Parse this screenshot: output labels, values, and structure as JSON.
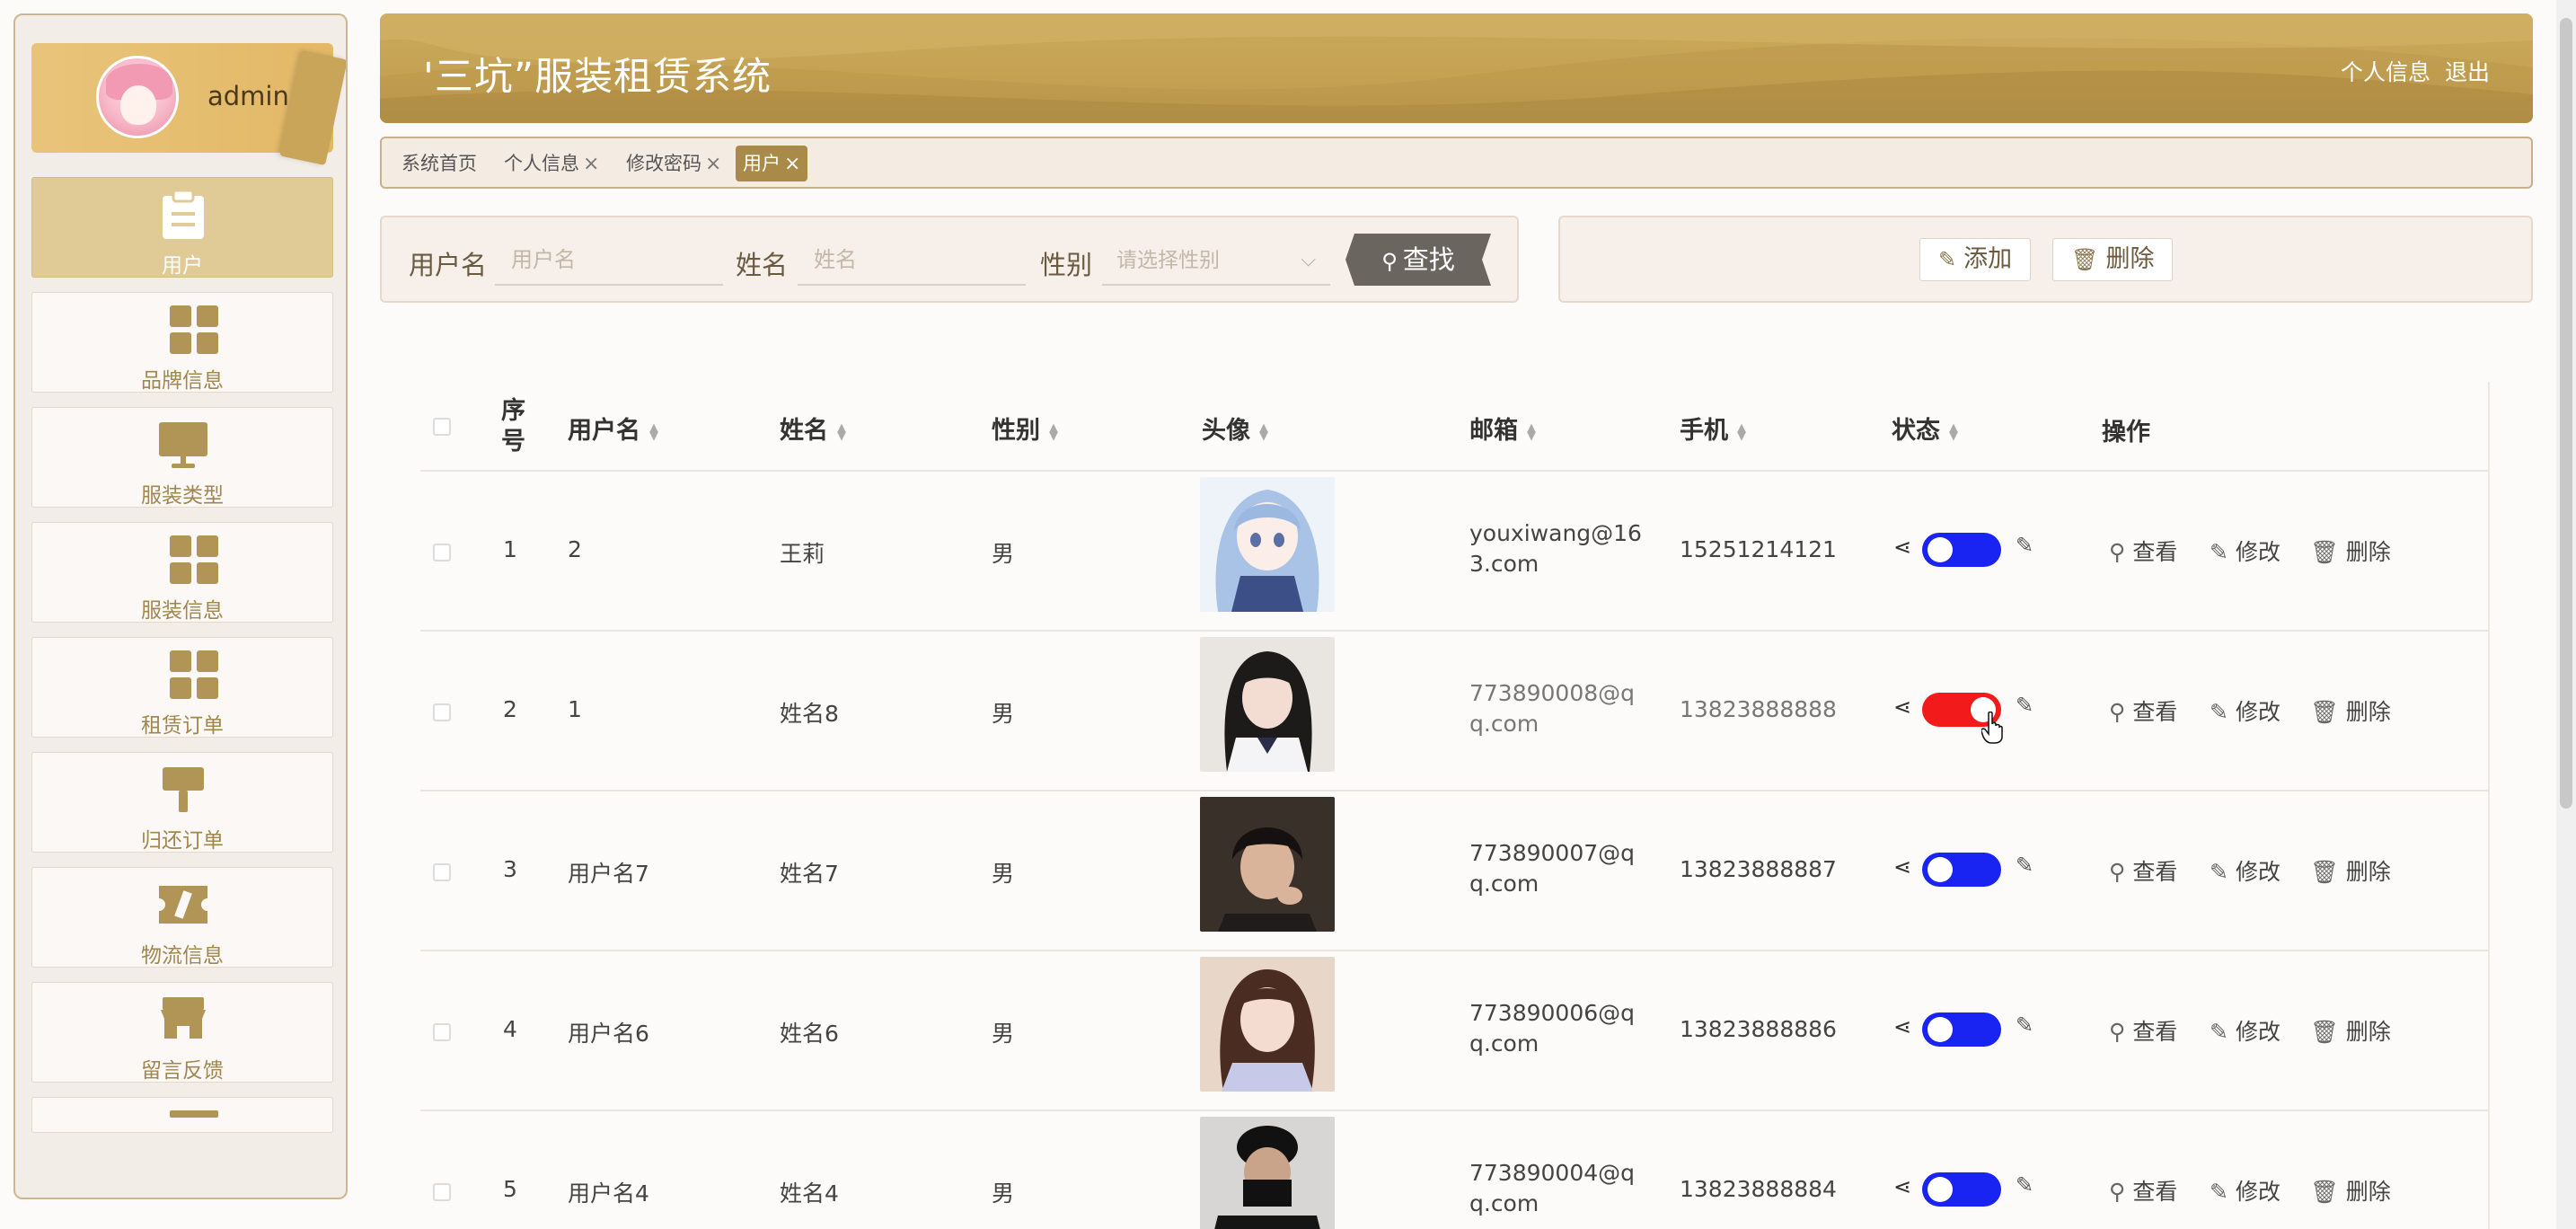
{
  "user": {
    "name": "admin"
  },
  "sidebar": {
    "items": [
      {
        "label": "用户",
        "icon": "clipboard-icon",
        "active": true
      },
      {
        "label": "品牌信息",
        "icon": "grid-icon"
      },
      {
        "label": "服装类型",
        "icon": "monitor-icon"
      },
      {
        "label": "服装信息",
        "icon": "grid-icon"
      },
      {
        "label": "租赁订单",
        "icon": "grid-icon"
      },
      {
        "label": "归还订单",
        "icon": "brush-icon"
      },
      {
        "label": "物流信息",
        "icon": "ticket-icon"
      },
      {
        "label": "留言反馈",
        "icon": "shop-icon"
      }
    ]
  },
  "header": {
    "title": "'三坑”服装租赁系统",
    "profile_link": "个人信息",
    "logout_link": "退出"
  },
  "tabs": [
    {
      "label": "系统首页",
      "closable": false
    },
    {
      "label": "个人信息",
      "closable": true
    },
    {
      "label": "修改密码",
      "closable": true
    },
    {
      "label": "用户",
      "closable": true,
      "active": true
    }
  ],
  "search": {
    "username_label": "用户名",
    "username_placeholder": "用户名",
    "name_label": "姓名",
    "name_placeholder": "姓名",
    "gender_label": "性别",
    "gender_placeholder": "请选择性别",
    "search_button": "查找"
  },
  "actions": {
    "add": "添加",
    "delete": "删除"
  },
  "table": {
    "columns": {
      "index": "序号",
      "username": "用户名",
      "name": "姓名",
      "gender": "性别",
      "avatar": "头像",
      "email": "邮箱",
      "phone": "手机",
      "status": "状态",
      "ops": "操作"
    },
    "row_actions": {
      "view": "查看",
      "edit": "修改",
      "delete": "删除"
    },
    "rows": [
      {
        "index": "1",
        "username": "2",
        "name": "王莉",
        "gender": "男",
        "email": "youxiwang@163.com",
        "phone": "15251214121",
        "status_on": false
      },
      {
        "index": "2",
        "username": "1",
        "name": "姓名8",
        "gender": "男",
        "email": "773890008@qq.com",
        "phone": "13823888888",
        "status_on": true
      },
      {
        "index": "3",
        "username": "用户名7",
        "name": "姓名7",
        "gender": "男",
        "email": "773890007@qq.com",
        "phone": "13823888887",
        "status_on": false
      },
      {
        "index": "4",
        "username": "用户名6",
        "name": "姓名6",
        "gender": "男",
        "email": "773890006@qq.com",
        "phone": "13823888886",
        "status_on": false
      },
      {
        "index": "5",
        "username": "用户名4",
        "name": "姓名4",
        "gender": "男",
        "email": "773890004@qq.com",
        "phone": "13823888884",
        "status_on": false
      }
    ]
  },
  "colors": {
    "accent": "#c5a253",
    "toggle_off": "#1a24f2",
    "toggle_on": "#f21a1a"
  }
}
